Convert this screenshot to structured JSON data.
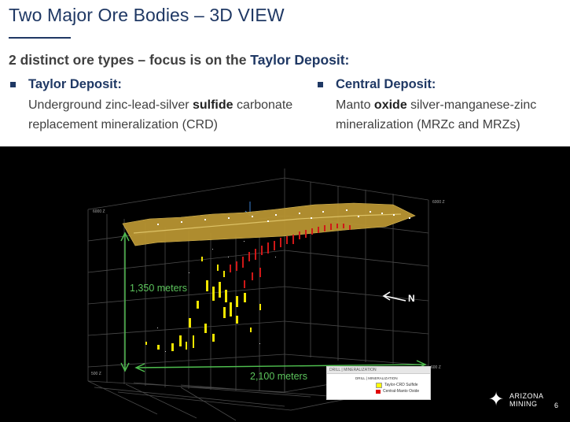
{
  "slide": {
    "title": "Two Major Ore Bodies –  3D VIEW",
    "subtitle_prefix": "2 distinct ore types – focus is on the ",
    "subtitle_highlight": "Taylor Deposit:",
    "page_number": "6"
  },
  "deposits": [
    {
      "name": "Taylor Deposit:",
      "desc_pre": "Underground zinc-lead-silver ",
      "desc_bold": "sulfide",
      "desc_post": " carbonate replacement mineralization (CRD)"
    },
    {
      "name": "Central Deposit:",
      "desc_pre": "Manto ",
      "desc_bold": "oxide",
      "desc_post": " silver-manganese-zinc mineralization (MRZc and MRZs)"
    }
  ],
  "view3d": {
    "vertical_measure": "1,350 meters",
    "horizontal_measure": "2,100 meters",
    "north_label": "N",
    "axis_labels": {
      "top_left": "6000 Z",
      "top_right": "6000 Z",
      "bottom_right": "600 Z",
      "bottom_left": "500 Z"
    },
    "legend": {
      "header": "DRILL | MINERALIZATION",
      "title": "DRILL | MINERALIZATION",
      "items": [
        {
          "label": "Taylor-CRD Sulfide",
          "color": "#ffff00"
        },
        {
          "label": "Central-Manto Oxide",
          "color": "#e00000"
        }
      ]
    }
  },
  "brand": {
    "line1": "ARIZONA",
    "line2": "MINING"
  },
  "colors": {
    "title": "#1f3864",
    "measure": "#5cc45c",
    "ore_surface": "#c8a23a"
  }
}
